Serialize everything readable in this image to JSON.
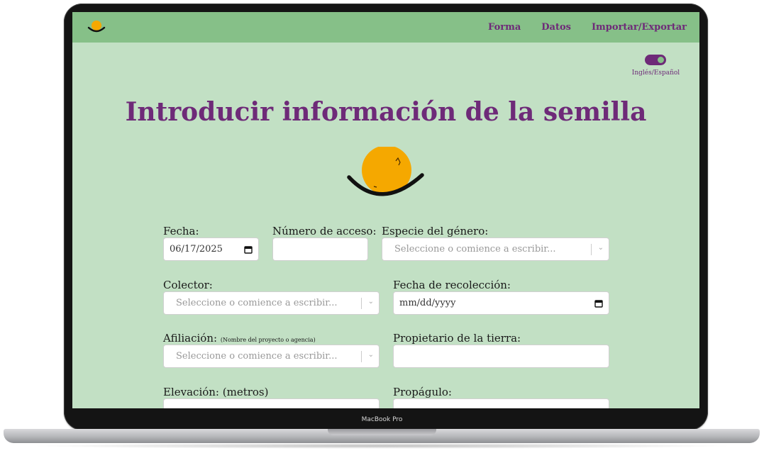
{
  "device": {
    "label": "MacBook Pro"
  },
  "nav": {
    "links": [
      {
        "label": "Forma"
      },
      {
        "label": "Datos"
      },
      {
        "label": "Importar/Exportar"
      }
    ]
  },
  "language": {
    "label": "Inglés/Español",
    "enabled": true
  },
  "page": {
    "title": "Introducir información de la semilla"
  },
  "form": {
    "fecha": {
      "label": "Fecha:",
      "value": "06/17/2025"
    },
    "numero_acceso": {
      "label": "Número de acceso:",
      "value": ""
    },
    "especie": {
      "label": "Especie del género:",
      "placeholder": "Seleccione o comience a escribir..."
    },
    "colector": {
      "label": "Colector:",
      "placeholder": "Seleccione o comience a escribir..."
    },
    "fecha_recoleccion": {
      "label": "Fecha de recolección:",
      "value": "mm/dd/yyyy"
    },
    "afiliacion": {
      "label": "Afiliación:",
      "note": "(Nombre del proyecto o agencia)",
      "placeholder": "Seleccione o comience a escribir..."
    },
    "propietario": {
      "label": "Propietario de la tierra:",
      "value": ""
    },
    "elevacion": {
      "label": "Elevación: (metros)"
    },
    "propagulo": {
      "label": "Propágulo:"
    }
  },
  "colors": {
    "accent": "#6e2a78",
    "nav_bg": "#86c088",
    "page_bg": "#c2e0c4",
    "logo_orange": "#f5a800"
  }
}
